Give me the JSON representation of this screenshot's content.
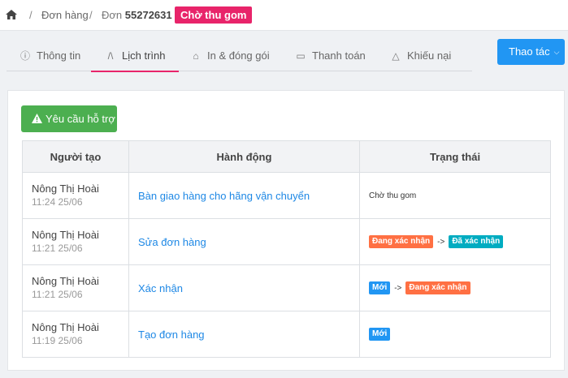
{
  "breadcrumb": {
    "orders_label": "Đơn hàng",
    "order_prefix": "Đơn",
    "order_number": "55272631",
    "status": "Chờ thu gom",
    "status_color": "#e8246a"
  },
  "tabs": [
    {
      "label": "Thông tin",
      "icon": "info-circle-icon"
    },
    {
      "label": "Lịch trình",
      "icon": "road-icon"
    },
    {
      "label": "In & đóng gói",
      "icon": "inbox-icon"
    },
    {
      "label": "Thanh toán",
      "icon": "money-icon"
    },
    {
      "label": "Khiếu nại",
      "icon": "warning-icon"
    }
  ],
  "active_tab": "Lịch trình",
  "actions_label": "Thao tác",
  "support_label": "Yêu cầu hỗ trợ",
  "table": {
    "headers": [
      "Người tạo",
      "Hành động",
      "Trạng thái"
    ],
    "rows": [
      {
        "creator": "Nông Thị Hoài",
        "time": "11:24 25/06",
        "action": "Bàn giao hàng cho hãng vận chuyển",
        "status_text": "Chờ thu gom",
        "from": "",
        "to": ""
      },
      {
        "creator": "Nông Thị Hoài",
        "time": "11:21 25/06",
        "action": "Sửa đơn hàng",
        "status_text": "",
        "from": "Đang xác nhận",
        "to": "Đã xác nhận"
      },
      {
        "creator": "Nông Thị Hoài",
        "time": "11:21 25/06",
        "action": "Xác nhận",
        "status_text": "",
        "from": "Mới",
        "to": "Đang xác nhận"
      },
      {
        "creator": "Nông Thị Hoài",
        "time": "11:19 25/06",
        "action": "Tạo đơn hàng",
        "status_text": "",
        "from": "Mới",
        "to": ""
      }
    ]
  },
  "arrow_text": "->",
  "status_colors": {
    "Mới": "#2196f3",
    "Đang xác nhận": "#ff7043",
    "Đã xác nhận": "#00acc1"
  },
  "colors": {
    "accent": "#e8246a",
    "primary": "#2196f3",
    "success": "#4caf50",
    "link": "#1e88e5"
  }
}
